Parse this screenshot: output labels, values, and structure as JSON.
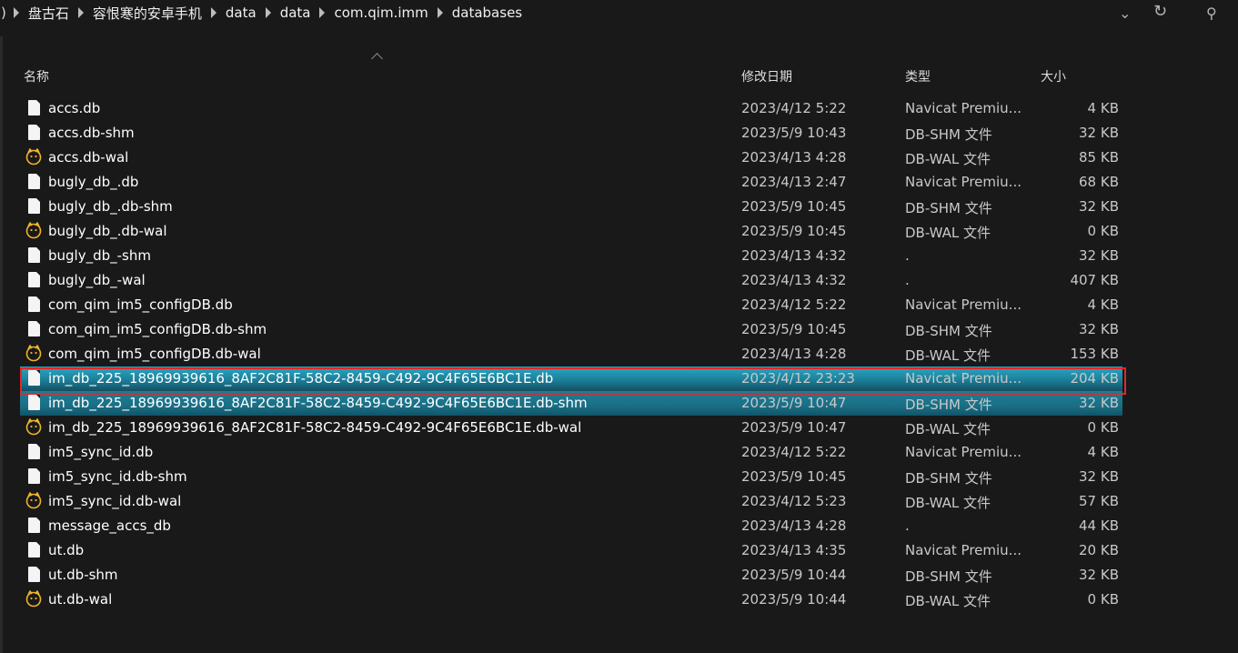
{
  "breadcrumb": {
    "items": [
      "盘古石",
      "容恨寒的安卓手机",
      "data",
      "data",
      "com.qim.imm",
      "databases"
    ]
  },
  "toolbar": {
    "dropdown_icon": "chevron-down-icon",
    "refresh_icon": "refresh-icon",
    "search_icon": "search-icon"
  },
  "columns": {
    "name": "名称",
    "date": "修改日期",
    "type": "类型",
    "size": "大小"
  },
  "files": [
    {
      "name": "accs.db",
      "date": "2023/4/12 5:22",
      "type": "Navicat Premiu...",
      "size": "4 KB",
      "icon": "file-icon"
    },
    {
      "name": "accs.db-shm",
      "date": "2023/5/9 10:43",
      "type": "DB-SHM 文件",
      "size": "32 KB",
      "icon": "file-icon"
    },
    {
      "name": "accs.db-wal",
      "date": "2023/4/13 4:28",
      "type": "DB-WAL 文件",
      "size": "85 KB",
      "icon": "wal-icon"
    },
    {
      "name": "bugly_db_.db",
      "date": "2023/4/13 2:47",
      "type": "Navicat Premiu...",
      "size": "68 KB",
      "icon": "file-icon"
    },
    {
      "name": "bugly_db_.db-shm",
      "date": "2023/5/9 10:45",
      "type": "DB-SHM 文件",
      "size": "32 KB",
      "icon": "file-icon"
    },
    {
      "name": "bugly_db_.db-wal",
      "date": "2023/5/9 10:45",
      "type": "DB-WAL 文件",
      "size": "0 KB",
      "icon": "wal-icon"
    },
    {
      "name": "bugly_db_-shm",
      "date": "2023/4/13 4:32",
      "type": ".",
      "size": "32 KB",
      "icon": "file-icon"
    },
    {
      "name": "bugly_db_-wal",
      "date": "2023/4/13 4:32",
      "type": ".",
      "size": "407 KB",
      "icon": "file-icon"
    },
    {
      "name": "com_qim_im5_configDB.db",
      "date": "2023/4/12 5:22",
      "type": "Navicat Premiu...",
      "size": "4 KB",
      "icon": "file-icon"
    },
    {
      "name": "com_qim_im5_configDB.db-shm",
      "date": "2023/5/9 10:45",
      "type": "DB-SHM 文件",
      "size": "32 KB",
      "icon": "file-icon"
    },
    {
      "name": "com_qim_im5_configDB.db-wal",
      "date": "2023/4/13 4:28",
      "type": "DB-WAL 文件",
      "size": "153 KB",
      "icon": "wal-icon"
    },
    {
      "name": "im_db_225_18969939616_8AF2C81F-58C2-8459-C492-9C4F65E6BC1E.db",
      "date": "2023/4/12 23:23",
      "type": "Navicat Premiu...",
      "size": "204 KB",
      "icon": "file-icon",
      "state": "selected"
    },
    {
      "name": "im_db_225_18969939616_8AF2C81F-58C2-8459-C492-9C4F65E6BC1E.db-shm",
      "date": "2023/5/9 10:47",
      "type": "DB-SHM 文件",
      "size": "32 KB",
      "icon": "file-icon",
      "state": "selected-soft"
    },
    {
      "name": "im_db_225_18969939616_8AF2C81F-58C2-8459-C492-9C4F65E6BC1E.db-wal",
      "date": "2023/5/9 10:47",
      "type": "DB-WAL 文件",
      "size": "0 KB",
      "icon": "wal-icon"
    },
    {
      "name": "im5_sync_id.db",
      "date": "2023/4/12 5:22",
      "type": "Navicat Premiu...",
      "size": "4 KB",
      "icon": "file-icon"
    },
    {
      "name": "im5_sync_id.db-shm",
      "date": "2023/5/9 10:45",
      "type": "DB-SHM 文件",
      "size": "32 KB",
      "icon": "file-icon"
    },
    {
      "name": "im5_sync_id.db-wal",
      "date": "2023/4/12 5:23",
      "type": "DB-WAL 文件",
      "size": "57 KB",
      "icon": "wal-icon"
    },
    {
      "name": "message_accs_db",
      "date": "2023/4/13 4:28",
      "type": ".",
      "size": "44 KB",
      "icon": "file-icon"
    },
    {
      "name": "ut.db",
      "date": "2023/4/13 4:35",
      "type": "Navicat Premiu...",
      "size": "20 KB",
      "icon": "file-icon"
    },
    {
      "name": "ut.db-shm",
      "date": "2023/5/9 10:44",
      "type": "DB-SHM 文件",
      "size": "32 KB",
      "icon": "file-icon"
    },
    {
      "name": "ut.db-wal",
      "date": "2023/5/9 10:44",
      "type": "DB-WAL 文件",
      "size": "0 KB",
      "icon": "wal-icon"
    }
  ],
  "colors": {
    "background": "#191919",
    "selection": "#1c7f99",
    "highlight_border": "#e0282c",
    "wal_icon": "#f0b429"
  }
}
